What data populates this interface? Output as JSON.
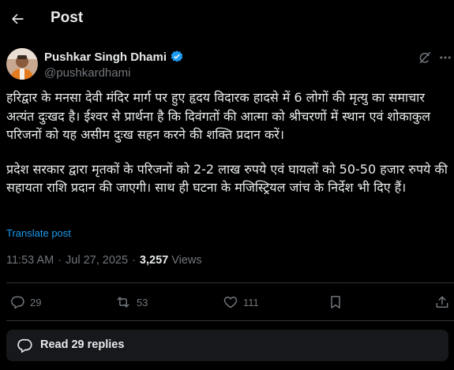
{
  "header": {
    "title": "Post"
  },
  "author": {
    "name": "Pushkar Singh Dhami",
    "handle": "@pushkardhami",
    "verified": true
  },
  "post": {
    "paragraphs": [
      "हरिद्वार के मनसा देवी मंदिर मार्ग पर हुए हृदय विदारक हादसे में 6 लोगों की मृत्यु का समाचार अत्यंत दुःखद है। ईश्वर से प्रार्थना है कि दिवंगतों की आत्मा को श्रीचरणों में स्थान एवं शोकाकुल परिजनों को यह असीम दुःख सहन करने की शक्ति प्रदान करें।",
      "प्रदेश सरकार द्वारा मृतकों के परिजनों को 2-2 लाख रुपये एवं घायलों को 50-50 हजार रुपये की सहायता राशि प्रदान की जाएगी। साथ ही घटना के मजिस्ट्रियल जांच के निर्देश भी दिए हैं।"
    ],
    "translate_label": "Translate post",
    "time": "11:53 AM",
    "separator": "·",
    "date": "Jul 27, 2025",
    "views_count": "3,257",
    "views_label": "Views"
  },
  "actions": {
    "replies": "29",
    "reposts": "53",
    "likes": "111"
  },
  "replies_card": {
    "label": "Read 29 replies"
  },
  "colors": {
    "background": "#000000",
    "text": "#e7e9ea",
    "muted": "#71767b",
    "accent": "#1d9bf0",
    "divider": "#2f3336",
    "card": "#16181c"
  }
}
